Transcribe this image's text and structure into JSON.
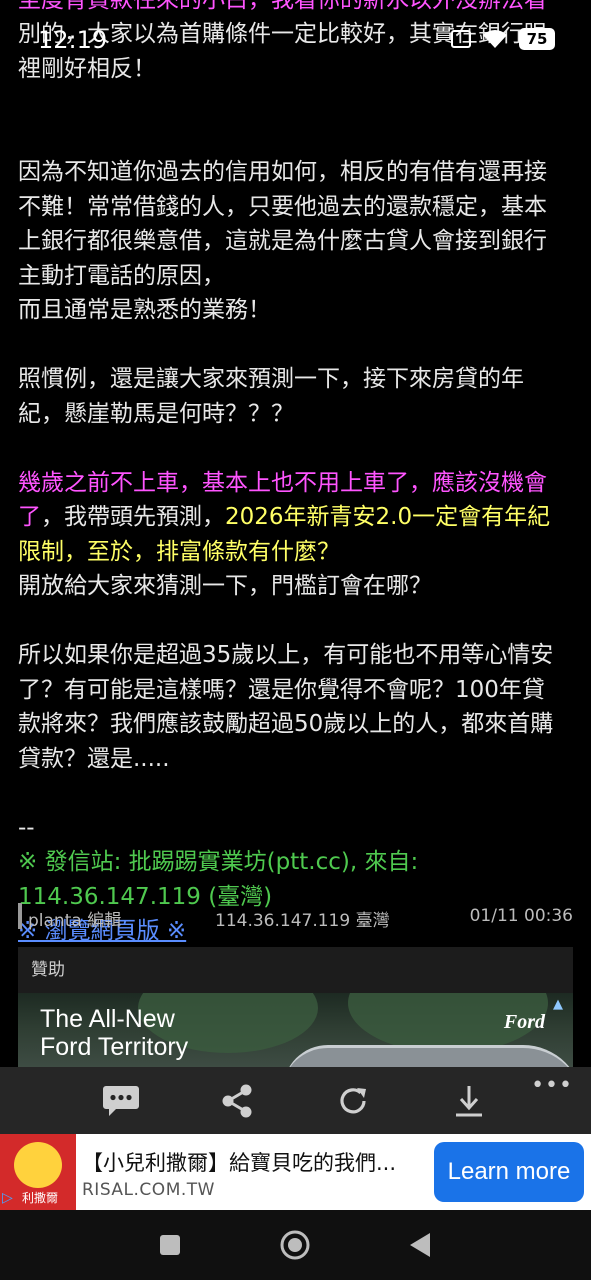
{
  "status_bar": {
    "time": "12:19",
    "battery": "75"
  },
  "article": {
    "clip_line_partial": "至度背貸款往來的小白，我看你的新水以外沒辦法看",
    "para1": [
      "別的，大家以為首購條件一定比較好，其實在銀行眼",
      "裡剛好相反！"
    ],
    "para2": [
      "因為不知道你過去的信用如何，相反的有借有還再接",
      "不難！常常借錢的人，只要他過去的還款穩定，基本",
      "上銀行都很樂意借，這就是為什麼古貸人會接到銀行",
      "主動打電話的原因，",
      "而且通常是熟悉的業務！"
    ],
    "para3": [
      "照慣例，還是讓大家來預測一下，接下來房貸的年",
      "紀，懸崖勒馬是何時？？？"
    ],
    "para4": {
      "l1": "幾歲之前不上車，基本上也不用上車了，應該沒機會",
      "l2_magenta": "了",
      "l2_white": "，我帶頭先預測，",
      "l2_yellow": "2026年新青安2.0一定會有年紀",
      "l3": "限制，至於，排富條款有什麼？",
      "l4": "開放給大家來猜測一下，門檻訂會在哪？"
    },
    "para5": [
      "所以如果你是超過35歲以上，有可能也不用等心情安",
      "了？有可能是這樣嗎？還是你覺得不會呢？100年貸",
      "款將來？我們應該鼓勵超過50歲以上的人，都來首購",
      "貸款？還是....."
    ],
    "signature_dash": "--",
    "origin_line1": "※ 發信站: 批踢踢實業坊(ptt.cc), 來自:",
    "origin_line2": "114.36.147.119 (臺灣)",
    "web_link": "※ 瀏覽網頁版 ※"
  },
  "meta": {
    "user": "planta 編輯",
    "ip": "114.36.147.119 臺灣",
    "time": "01/11 00:36"
  },
  "sponsor": {
    "label": "贊助",
    "headline": [
      "The All-New",
      "Ford Territory"
    ],
    "brand": "Ford"
  },
  "toolbar": {
    "more": "•••"
  },
  "ad_banner": {
    "title": "【小兒利撒爾】給寶貝吃的我們...",
    "domain": "RISAL.COM.TW",
    "cta": "Learn more",
    "logo_text": "利撒爾"
  },
  "icons": [
    "comment-icon",
    "share-icon",
    "refresh-icon",
    "download-icon",
    "square-icon",
    "circle-icon",
    "back-icon"
  ]
}
